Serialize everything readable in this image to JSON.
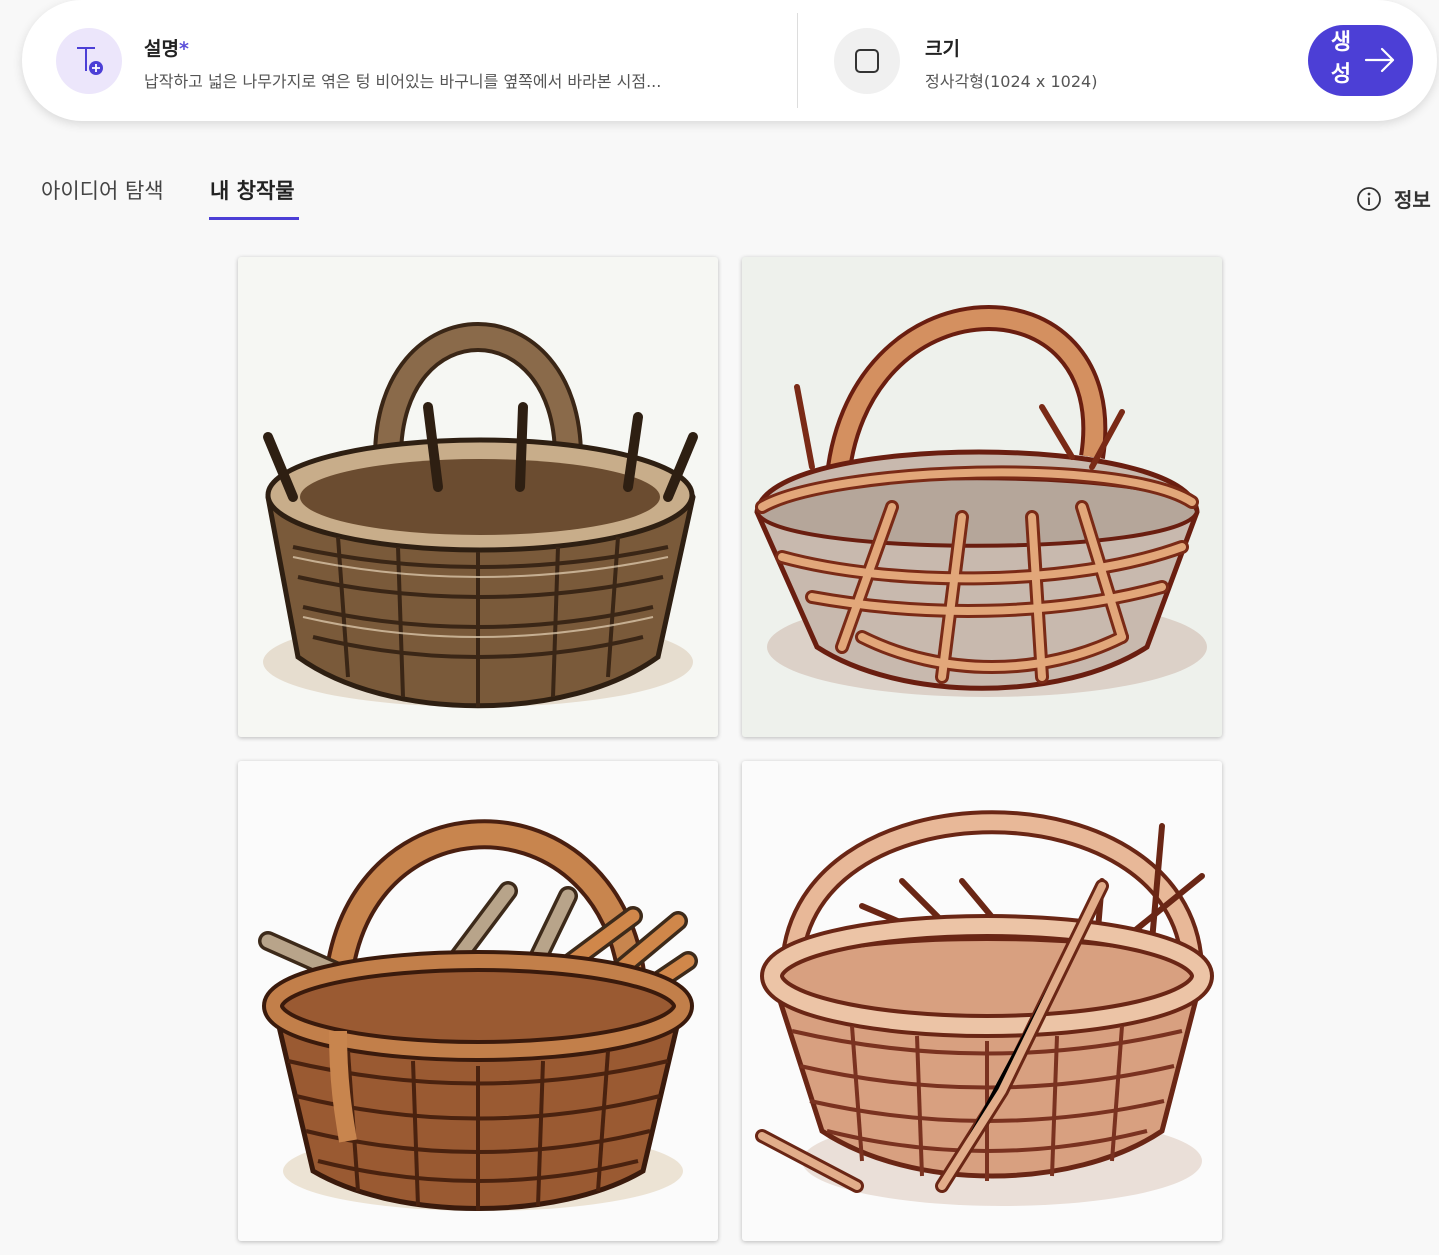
{
  "prompt_bar": {
    "description": {
      "title": "설명",
      "required_mark": "*",
      "value": "납작하고 넓은 나무가지로 엮은 텅 비어있는 바구니를 옆쪽에서 바라본 시점...",
      "icon": "text-add-icon"
    },
    "size": {
      "title": "크기",
      "value": "정사각형(1024 x 1024)",
      "icon": "square-icon"
    },
    "generate_label": "생성",
    "generate_icon": "arrow-right-icon"
  },
  "tabs": [
    {
      "label": "아이디어 탐색",
      "active": false
    },
    {
      "label": "내 창작물",
      "active": true
    }
  ],
  "info_label": "정보",
  "gallery": [
    {
      "subject": "basket-image-1",
      "palette": "dark-brown"
    },
    {
      "subject": "basket-image-2",
      "palette": "reddish-brown"
    },
    {
      "subject": "basket-image-3",
      "palette": "brown-with-sticks"
    },
    {
      "subject": "basket-image-4",
      "palette": "light-brown-with-branches"
    }
  ],
  "colors": {
    "accent": "#4c3fd6",
    "background": "#f8f8f8"
  }
}
